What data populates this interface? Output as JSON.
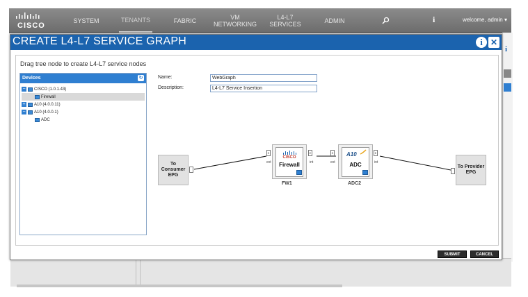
{
  "nav": {
    "logo": "CISCO",
    "items": [
      "SYSTEM",
      "TENANTS",
      "FABRIC",
      "VM\nNETWORKING",
      "L4-L7 SERVICES",
      "ADMIN"
    ],
    "search_icon": "search-icon",
    "info_icon": "info-icon",
    "welcome": "welcome, admin"
  },
  "dialog": {
    "title": "CREATE L4-L7 SERVICE GRAPH",
    "instruction": "Drag tree node to create L4-L7 service nodes",
    "devices_header": "Devices",
    "tree": [
      {
        "label": "CISCO (1.0.1.43)",
        "expander": "−"
      },
      {
        "label": "Firewall"
      },
      {
        "label": "A10 (4.0.0.11)",
        "expander": "+"
      },
      {
        "label": "A10 (4.0.0.1)",
        "expander": "−"
      },
      {
        "label": "ADC"
      }
    ],
    "name_label": "Name:",
    "name_value": "WebGraph",
    "description_label": "Description:",
    "description_value": "L4-L7 Service Insertion",
    "consumer_epg": "To\nConsumer\nEPG",
    "provider_epg": "To Provider\nEPG",
    "fw_node": {
      "brand": "CISCO",
      "label": "Firewall",
      "name": "FW1",
      "ext": "ext",
      "int": "int",
      "conn": "E"
    },
    "adc_node": {
      "brand": "A10",
      "label": "ADC",
      "name": "ADC2",
      "ext": "ext",
      "int": "int",
      "conn": "E"
    },
    "submit": "SUBMIT",
    "cancel": "CANCEL",
    "info_btn": "i",
    "close_btn": "✕"
  },
  "colors": {
    "header_blue": "#1b63ae",
    "tree_header": "#2f7fd1",
    "nav_gray": "#7a7a7a"
  }
}
